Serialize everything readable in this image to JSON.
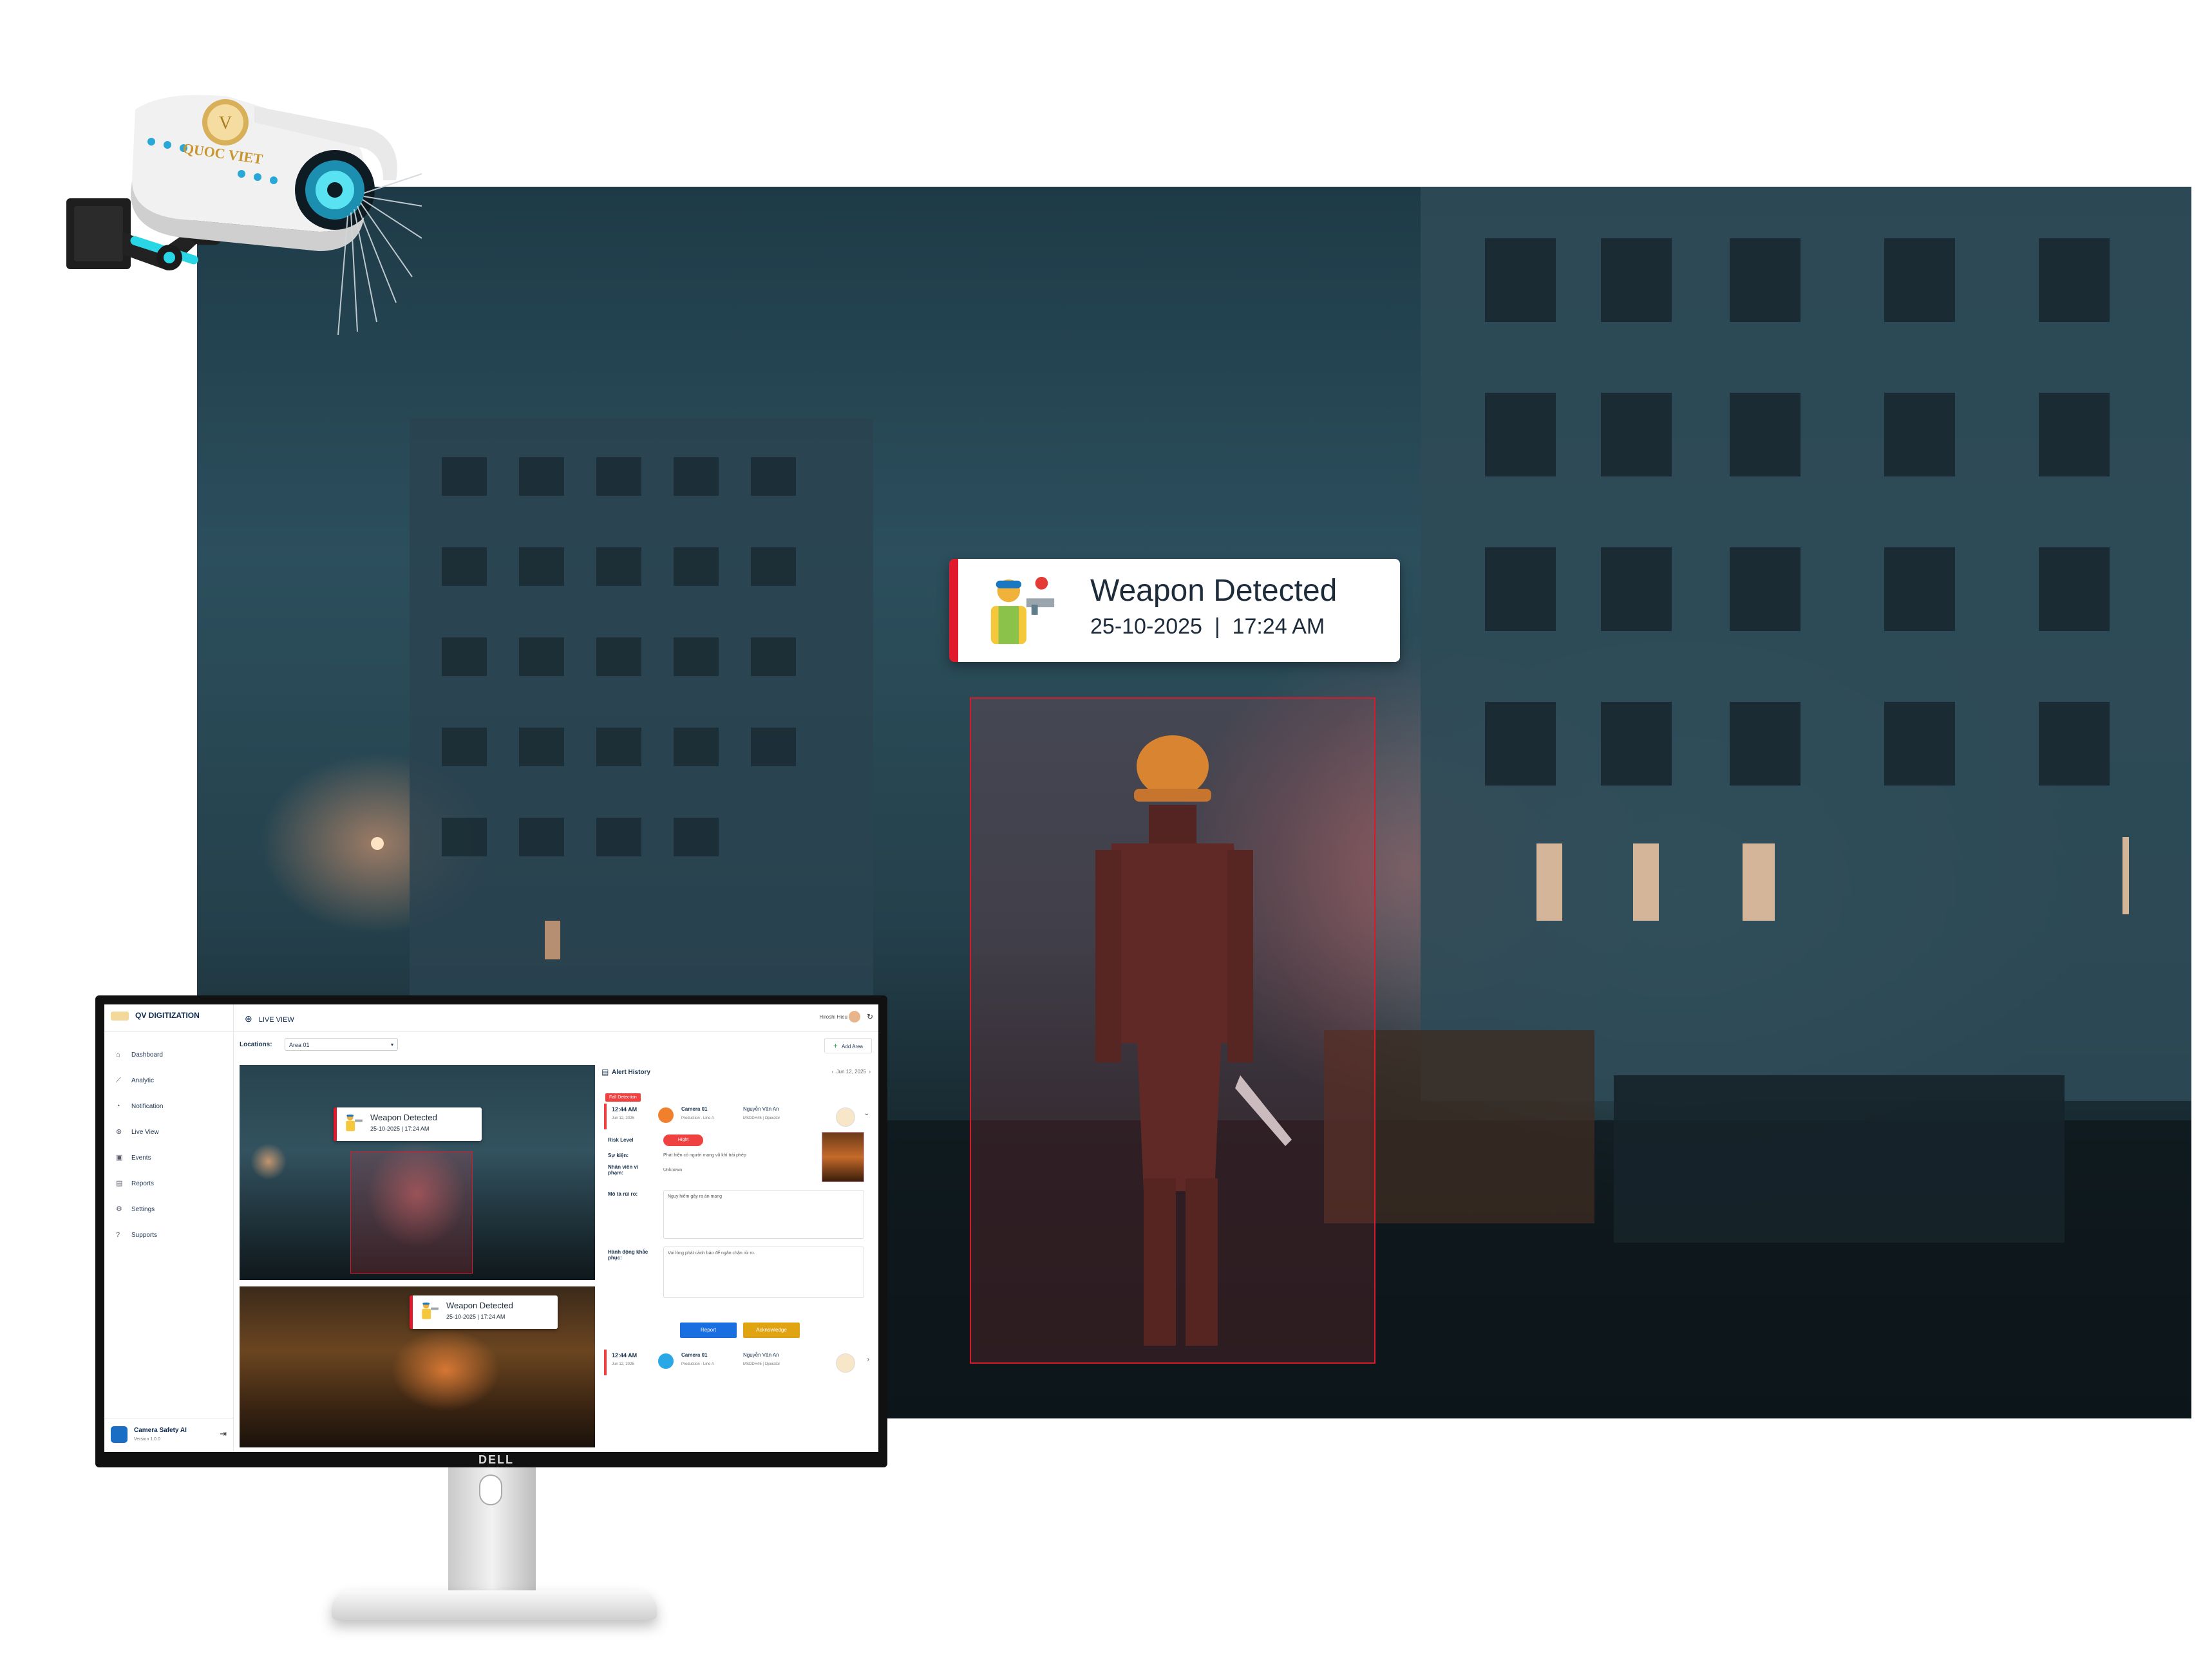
{
  "scene": {
    "alert": {
      "title": "Weapon Detected",
      "date": "25-10-2025",
      "time": "17:24 AM"
    }
  },
  "camera": {
    "brand": "QUOC VIET"
  },
  "monitor": {
    "logo": "DELL",
    "app": {
      "brand": "QV DIGITIZATION",
      "page_title": "LIVE VIEW",
      "user": "Hiroshi Hieu",
      "nav": [
        {
          "label": "Dashboard",
          "icon": "dashboard-icon",
          "glyph": "⌂"
        },
        {
          "label": "Analytic",
          "icon": "analytic-icon",
          "glyph": "⟋"
        },
        {
          "label": "Notification",
          "icon": "bell-icon",
          "glyph": "◔"
        },
        {
          "label": "Live View",
          "icon": "live-view-icon",
          "glyph": "⊛"
        },
        {
          "label": "Events",
          "icon": "events-icon",
          "glyph": "▣"
        },
        {
          "label": "Reports",
          "icon": "reports-icon",
          "glyph": "▤"
        },
        {
          "label": "Settings",
          "icon": "settings-icon",
          "glyph": "⚙"
        },
        {
          "label": "Supports",
          "icon": "support-icon",
          "glyph": "?"
        }
      ],
      "footer": {
        "app_name": "Camera Safety AI",
        "version": "Version 1.0.0"
      },
      "locations_label": "Locations:",
      "location_value": "Area 01",
      "add_area": "Add Area",
      "feeds": [
        {
          "alert_title": "Weapon Detected",
          "alert_time": "25-10-2025  |  17:24 AM"
        },
        {
          "alert_title": "Weapon Detected",
          "alert_time": "25-10-2025  |  17:24 AM"
        }
      ],
      "alert_history": {
        "title": "Alert History",
        "date": "Jun 12, 2025",
        "badge": "Fall Detection",
        "entries": [
          {
            "time": "12:44 AM",
            "date": "Jun 12, 2025",
            "camera": "Camera 01",
            "line": "Production - Line A",
            "person": "Nguyễn Văn An",
            "role": "MSDDH45 | Operator"
          },
          {
            "time": "12:44 AM",
            "date": "Jun 12, 2025",
            "camera": "Camera 01",
            "line": "Production - Line A",
            "person": "Nguyễn Văn An",
            "role": "MSDDH45 | Operator"
          }
        ],
        "details": {
          "risk_label": "Risk Level",
          "risk_value": "Hight",
          "event_label": "Sự kiện:",
          "event_value": "Phát hiện có người mang vũ khí trái phép",
          "staff_label": "Nhân viên vi phạm:",
          "staff_value": "Unknown",
          "desc_label": "Mô tả rủi ro:",
          "desc_value": "Nguy hiểm gây ra án mạng",
          "action_label": "Hành động khắc phục:",
          "action_value": "Vui lòng phát cảnh báo để ngăn chặn rủi ro."
        },
        "report_button": "Report",
        "acknowledge_button": "Acknowledge"
      }
    }
  }
}
